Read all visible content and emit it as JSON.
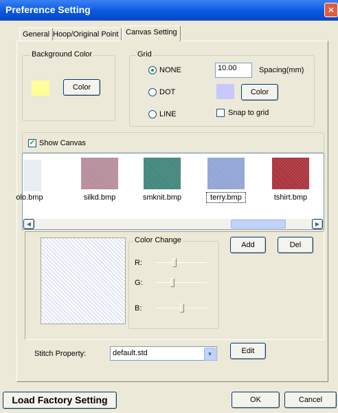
{
  "window": {
    "title": "Preference Setting",
    "close_glyph": "×"
  },
  "tabs": [
    {
      "label": "General"
    },
    {
      "label": "Hoop/Original Point"
    },
    {
      "label": "Canvas Setting",
      "active": true
    }
  ],
  "background_color": {
    "legend": "Background Color",
    "button": "Color",
    "swatch": "#ffff99"
  },
  "grid": {
    "legend": "Grid",
    "options": [
      {
        "label": "NONE",
        "checked": true
      },
      {
        "label": "DOT",
        "checked": false
      },
      {
        "label": "LINE",
        "checked": false
      }
    ],
    "spacing_value": "10.00",
    "spacing_label": "Spacing(mm)",
    "color_button": "Color",
    "color_swatch": "#c8c8ff",
    "snap_label": "Snap to grid",
    "snap_checked": false
  },
  "canvas": {
    "show_label": "Show Canvas",
    "show_checked": true,
    "thumbnails": [
      {
        "label": "olo.bmp",
        "color": "#e8ecf0"
      },
      {
        "label": "silkd.bmp",
        "color": "#b58b9a"
      },
      {
        "label": "smknit.bmp",
        "color": "#3e8479"
      },
      {
        "label": "terry.bmp",
        "color": "#8fa3d6"
      },
      {
        "label": "tshirt.bmp",
        "color": "#a9303a"
      }
    ],
    "preview_color": "#dfe4f4"
  },
  "color_change": {
    "legend": "Color Change",
    "channels": [
      {
        "label": "R:",
        "level": 0.4
      },
      {
        "label": "G:",
        "level": 0.35
      },
      {
        "label": "B:",
        "level": 0.55
      }
    ]
  },
  "actions": {
    "add": "Add",
    "del": "Del",
    "edit": "Edit"
  },
  "stitch": {
    "label": "Stitch Property:",
    "value": "default.std"
  },
  "footer": {
    "factory": "Load Factory Setting",
    "ok": "OK",
    "cancel": "Cancel"
  }
}
